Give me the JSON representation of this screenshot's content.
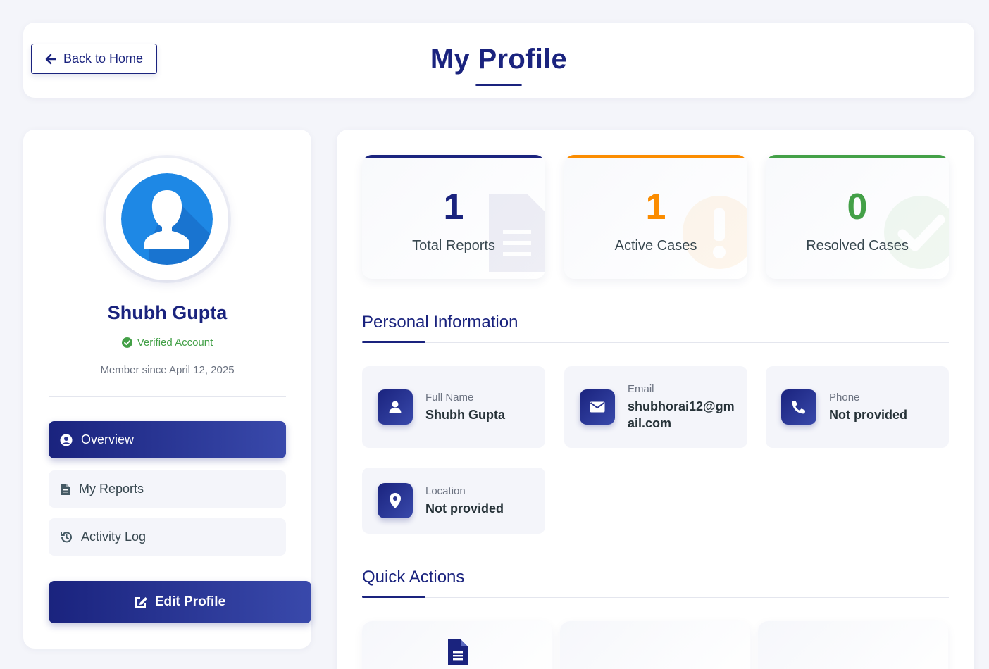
{
  "header": {
    "back_label": "Back to Home",
    "title": "My Profile"
  },
  "sidebar": {
    "user_name": "Shubh Gupta",
    "verified_label": "Verified Account",
    "member_since": "Member since April 12, 2025",
    "nav": [
      {
        "label": "Overview",
        "icon": "user-circle-icon",
        "active": true
      },
      {
        "label": "My Reports",
        "icon": "file-icon",
        "active": false
      },
      {
        "label": "Activity Log",
        "icon": "history-icon",
        "active": false
      }
    ],
    "edit_label": "Edit Profile"
  },
  "stats": [
    {
      "value": "1",
      "label": "Total Reports",
      "color": "#1a237e",
      "icon": "file-icon"
    },
    {
      "value": "1",
      "label": "Active Cases",
      "color": "#fb8c00",
      "icon": "exclamation-icon"
    },
    {
      "value": "0",
      "label": "Resolved Cases",
      "color": "#43a047",
      "icon": "check-icon"
    }
  ],
  "personal": {
    "title": "Personal Information",
    "fields": [
      {
        "label": "Full Name",
        "value": "Shubh Gupta",
        "icon": "user-icon"
      },
      {
        "label": "Email",
        "value": "shubhorai12@gmail.com",
        "icon": "envelope-icon"
      },
      {
        "label": "Phone",
        "value": "Not provided",
        "icon": "phone-icon"
      },
      {
        "label": "Location",
        "value": "Not provided",
        "icon": "location-pin-icon"
      }
    ]
  },
  "quick_actions": {
    "title": "Quick Actions"
  },
  "colors": {
    "primary": "#1a237e",
    "primary_light": "#3949ab",
    "active": "#fb8c00",
    "resolved": "#43a047",
    "background": "#f4f5fa"
  }
}
